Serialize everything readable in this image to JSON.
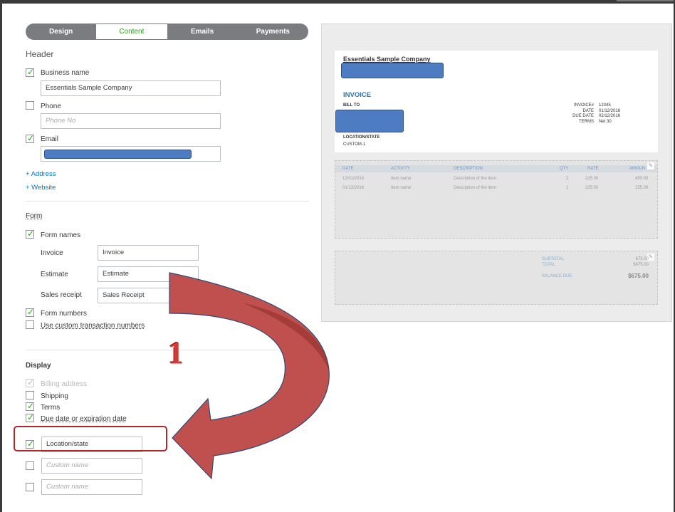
{
  "tabs": [
    {
      "label": "Design",
      "active": false
    },
    {
      "label": "Content",
      "active": true
    },
    {
      "label": "Emails",
      "active": false
    },
    {
      "label": "Payments",
      "active": false
    }
  ],
  "header": {
    "title": "Header",
    "business_name_label": "Business name",
    "business_name_value": "Essentials Sample Company",
    "phone_label": "Phone",
    "phone_placeholder": "Phone No",
    "email_label": "Email",
    "address_link": "+ Address",
    "website_link": "+ Website"
  },
  "form": {
    "title": "Form",
    "form_names_label": "Form names",
    "rows": [
      {
        "label": "Invoice",
        "value": "Invoice"
      },
      {
        "label": "Estimate",
        "value": "Estimate"
      },
      {
        "label": "Sales receipt",
        "value": "Sales Receipt"
      }
    ],
    "form_numbers_label": "Form numbers",
    "custom_numbers_label": "Use custom transaction numbers"
  },
  "display": {
    "title": "Display",
    "billing_address": "Billing address",
    "shipping": "Shipping",
    "terms": "Terms",
    "due_date": "Due date or expiration date",
    "location_value": "Location/state",
    "custom_placeholder_1": "Custom name",
    "custom_placeholder_2": "Custom name"
  },
  "preview": {
    "company": "Essentials Sample Company",
    "invoice_title": "INVOICE",
    "bill_to": "BILL TO",
    "meta_labels": [
      "INVOICE#",
      "DATE",
      "DUE DATE",
      "TERMS"
    ],
    "meta_values": [
      "12345",
      "01/12/2016",
      "02/12/2016",
      "Net 30"
    ],
    "location_label": "LOCATION/STATE",
    "custom_label": "CUSTOM-1",
    "columns": [
      "DATE",
      "ACTIVITY",
      "DESCRIPTION",
      "QTY",
      "RATE",
      "AMOUN"
    ],
    "rows": [
      [
        "12/01/2016",
        "Item name",
        "Description of the item",
        "2",
        "225.00",
        "450.00"
      ],
      [
        "01/12/2016",
        "Item name",
        "Description of the item",
        "1",
        "225.00",
        "225.00"
      ]
    ],
    "subtotal_label": "SUBTOTAL",
    "subtotal_value": "675.00",
    "total_label": "TOTAL",
    "total_value": "$675.00",
    "balance_label": "BALANCE DUE",
    "balance_value": "$675.00"
  },
  "annotation": {
    "step_number": "1",
    "arrow_color": "#c0504d",
    "highlight_color": "#b5252c"
  }
}
